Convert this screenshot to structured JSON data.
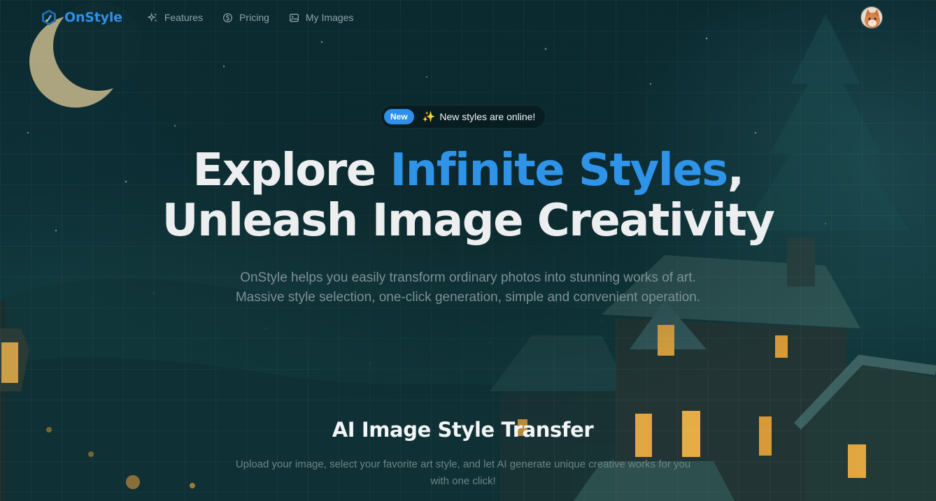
{
  "brand": {
    "name": "OnStyle"
  },
  "nav": [
    {
      "label": "Features",
      "icon": "sparkles-icon"
    },
    {
      "label": "Pricing",
      "icon": "coin-icon"
    },
    {
      "label": "My Images",
      "icon": "image-icon"
    }
  ],
  "badge": {
    "pill": "New",
    "text": "New styles are online!"
  },
  "hero": {
    "title_part1": "Explore ",
    "title_accent": "Infinite Styles",
    "title_comma": ",",
    "title_line2": "Unleash Image Creativity",
    "subtitle_line1": "OnStyle helps you easily transform ordinary photos into stunning works of art.",
    "subtitle_line2": "Massive style selection, one-click generation, simple and convenient operation."
  },
  "section": {
    "title": "AI Image Style Transfer",
    "description": "Upload your image, select your favorite art style, and let AI generate unique creative works for you with one click!"
  },
  "colors": {
    "accent": "#2f8fe6",
    "background": "#0d3036",
    "badge_pill": "#2f8fe6"
  }
}
